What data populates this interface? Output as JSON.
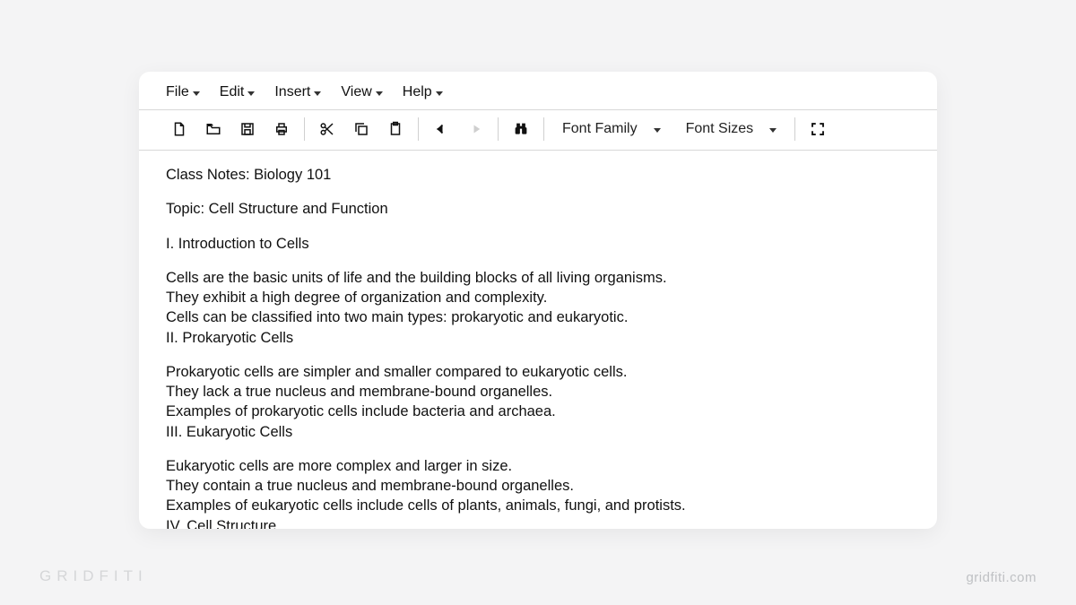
{
  "menubar": {
    "file": "File",
    "edit": "Edit",
    "insert": "Insert",
    "view": "View",
    "help": "Help"
  },
  "toolbar": {
    "font_family_label": "Font Family",
    "font_sizes_label": "Font Sizes"
  },
  "document": {
    "title": "Class Notes: Biology 101",
    "topic": "Topic: Cell Structure and Function",
    "section1_heading": "I. Introduction to Cells",
    "section1_line1": "Cells are the basic units of life and the building blocks of all living organisms.",
    "section1_line2": "They exhibit a high degree of organization and complexity.",
    "section1_line3": "Cells can be classified into two main types: prokaryotic and eukaryotic.",
    "section2_heading": "II. Prokaryotic Cells",
    "section2_line1": "Prokaryotic cells are simpler and smaller compared to eukaryotic cells.",
    "section2_line2": "They lack a true nucleus and membrane-bound organelles.",
    "section2_line3": "Examples of prokaryotic cells include bacteria and archaea.",
    "section3_heading": "III. Eukaryotic Cells",
    "section3_line1": "Eukaryotic cells are more complex and larger in size.",
    "section3_line2": "They contain a true nucleus and membrane-bound organelles.",
    "section3_line3": "Examples of eukaryotic cells include cells of plants, animals, fungi, and protists.",
    "section4_heading": "IV. Cell Structure"
  },
  "watermark": {
    "left": "GRIDFITI",
    "right": "gridfiti.com"
  }
}
